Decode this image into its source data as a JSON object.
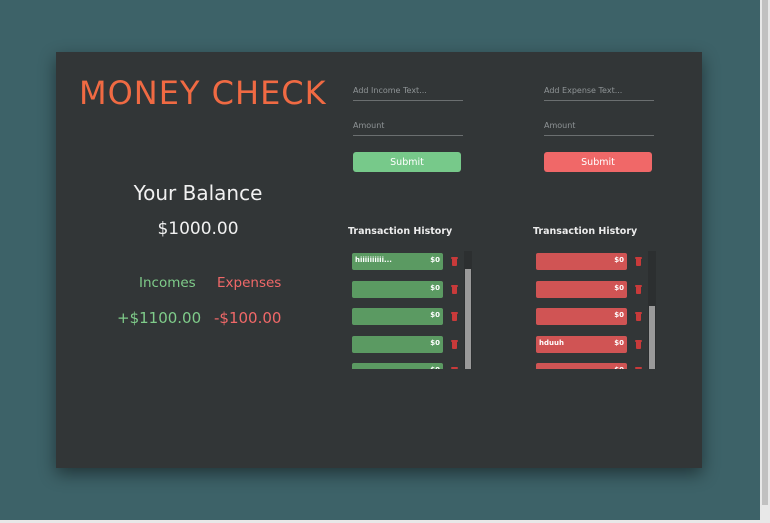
{
  "app": {
    "title": "MONEY CHECK"
  },
  "summary": {
    "balance_label": "Your Balance",
    "balance_value": "$1000.00",
    "incomes_label": "Incomes",
    "expenses_label": "Expenses",
    "incomes_value": "+$1100.00",
    "expenses_value": "-$100.00"
  },
  "income_form": {
    "text_placeholder": "Add Income Text...",
    "amount_placeholder": "Amount",
    "submit_label": "Submit"
  },
  "expense_form": {
    "text_placeholder": "Add Expense Text...",
    "amount_placeholder": "Amount",
    "submit_label": "Submit"
  },
  "income_history": {
    "title": "Transaction History",
    "items": [
      {
        "text": "hiiiiiiiiii...",
        "amount": "$0"
      },
      {
        "text": "",
        "amount": "$0"
      },
      {
        "text": "",
        "amount": "$0"
      },
      {
        "text": "",
        "amount": "$0"
      },
      {
        "text": "",
        "amount": "$0"
      }
    ]
  },
  "expense_history": {
    "title": "Transaction History",
    "items": [
      {
        "text": "",
        "amount": "$0"
      },
      {
        "text": "",
        "amount": "$0"
      },
      {
        "text": "",
        "amount": "$0"
      },
      {
        "text": "hduuh",
        "amount": "$0"
      },
      {
        "text": "",
        "amount": "$0"
      }
    ]
  },
  "colors": {
    "background": "#3d6268",
    "card": "#323637",
    "title_accent": "#f06a43",
    "income_green": "#77c98a",
    "expense_red": "#f06868"
  }
}
